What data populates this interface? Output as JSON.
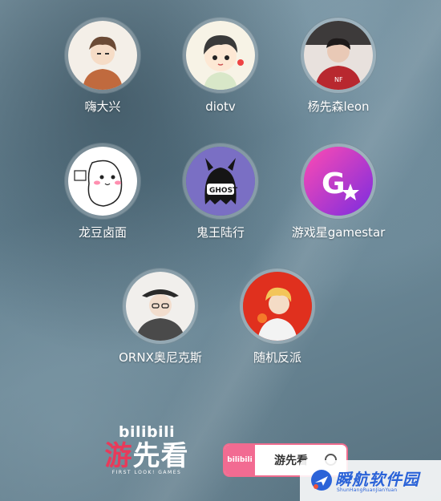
{
  "creators": [
    {
      "name": "嗨大兴",
      "avatar_icon": "anime-boy-avatar-icon",
      "accent": "#c06a3e"
    },
    {
      "name": "diotv",
      "avatar_icon": "cartoon-boy-avatar-icon",
      "accent": "#4a4a4a"
    },
    {
      "name": "杨先森leon",
      "avatar_icon": "man-red-hoodie-avatar-icon",
      "accent": "#b8282f"
    },
    {
      "name": "龙豆卤面",
      "avatar_icon": "doodle-character-avatar-icon",
      "accent": "#ff7aa0"
    },
    {
      "name": "鬼王陆行",
      "avatar_icon": "ghost-devil-avatar-icon",
      "accent": "#7a6fc4"
    },
    {
      "name": "游戏星gamestar",
      "avatar_icon": "gamestar-logo-avatar-icon",
      "accent": "#e23fae"
    },
    {
      "name": "ORNX奥尼克斯",
      "avatar_icon": "hat-glasses-avatar-icon",
      "accent": "#555555"
    },
    {
      "name": "随机反派",
      "avatar_icon": "blond-villain-avatar-icon",
      "accent": "#e0301e"
    }
  ],
  "footer": {
    "brand_top": "bilibili",
    "brand_main_1": "游",
    "brand_main_2": "先看",
    "brand_sub": "FIRST LOOK! GAMES",
    "search_logo": "bilibili",
    "search_text": "游先看"
  },
  "watermark": {
    "title": "瞬航软件园",
    "subtitle": "ShunHangRuanJianYuan"
  }
}
